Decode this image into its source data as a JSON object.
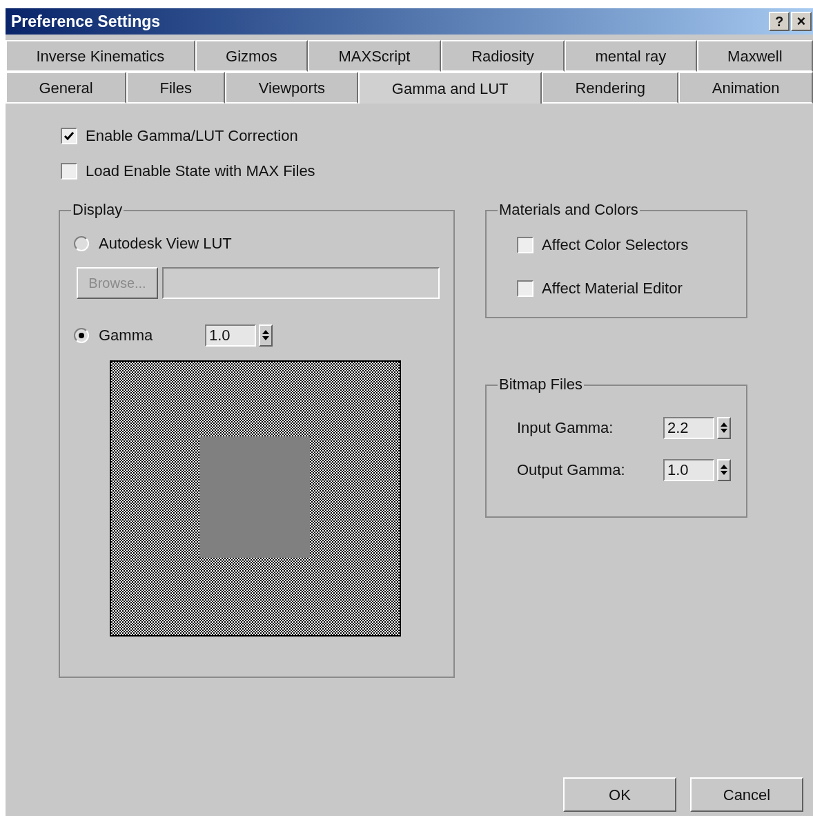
{
  "window": {
    "title": "Preference Settings",
    "help_button": "?",
    "close_button": "×"
  },
  "tab_rows": [
    [
      {
        "label": "Inverse Kinematics",
        "selected": false
      },
      {
        "label": "Gizmos",
        "selected": false
      },
      {
        "label": "MAXScript",
        "selected": false
      },
      {
        "label": "Radiosity",
        "selected": false
      },
      {
        "label": "mental ray",
        "selected": false
      },
      {
        "label": "Maxwell",
        "selected": false
      }
    ],
    [
      {
        "label": "General",
        "selected": false
      },
      {
        "label": "Files",
        "selected": false
      },
      {
        "label": "Viewports",
        "selected": false
      },
      {
        "label": "Gamma and LUT",
        "selected": true
      },
      {
        "label": "Rendering",
        "selected": false
      },
      {
        "label": "Animation",
        "selected": false
      }
    ]
  ],
  "options": [
    {
      "label": "Enable Gamma/LUT Correction",
      "checked": true
    },
    {
      "label": "Load Enable State with MAX Files",
      "checked": false
    }
  ],
  "display": {
    "title": "Display",
    "lut_radio": {
      "label": "Autodesk View LUT",
      "selected": false
    },
    "browse_button": {
      "label": "Browse...",
      "disabled": true
    },
    "gamma_radio": {
      "label": "Gamma",
      "selected": true
    },
    "gamma_value": "1.0"
  },
  "materials": {
    "title": "Materials and Colors",
    "options": [
      {
        "label": "Affect Color Selectors",
        "checked": false
      },
      {
        "label": "Affect Material Editor",
        "checked": false
      }
    ]
  },
  "bitmap": {
    "title": "Bitmap Files",
    "fields": [
      {
        "label": "Input Gamma:",
        "value": "2.2"
      },
      {
        "label": "Output Gamma:",
        "value": "1.0"
      }
    ]
  },
  "buttons": [
    "OK",
    "Cancel"
  ]
}
